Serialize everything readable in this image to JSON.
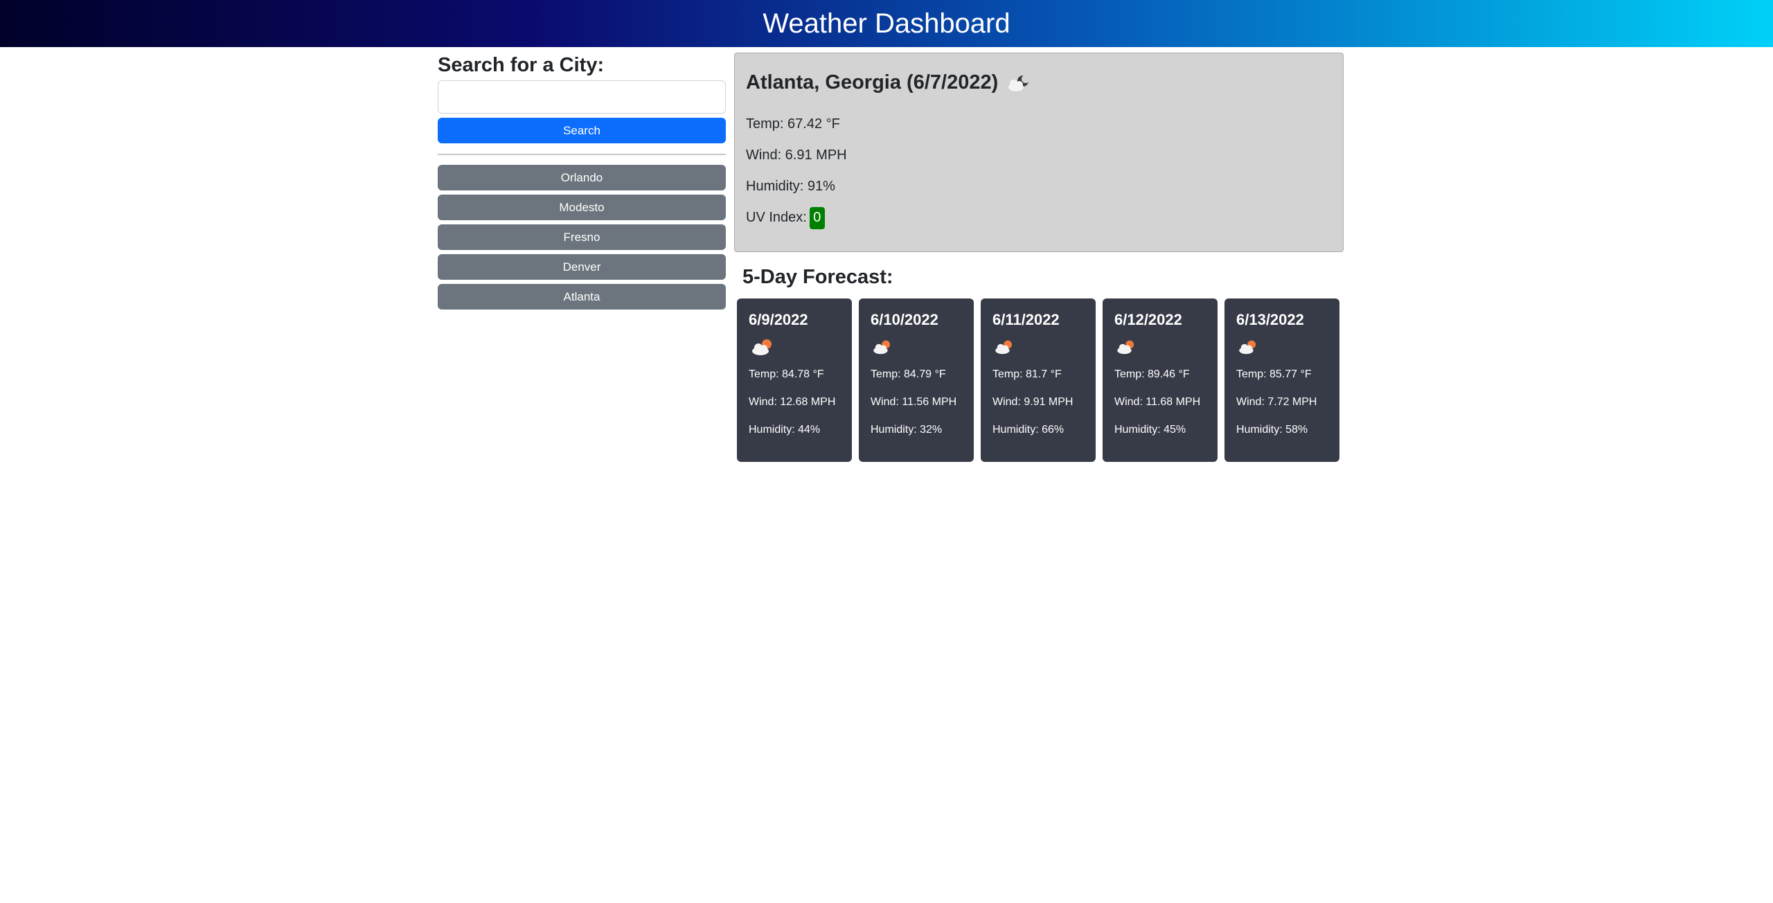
{
  "header": {
    "title": "Weather Dashboard"
  },
  "sidebar": {
    "heading": "Search for a City:",
    "search_value": "",
    "search_button": "Search",
    "history": [
      "Orlando",
      "Modesto",
      "Fresno",
      "Denver",
      "Atlanta"
    ]
  },
  "current": {
    "title": "Atlanta, Georgia (6/7/2022)",
    "icon": "cloud-moon-icon",
    "temp": "Temp: 67.42 °F",
    "wind": "Wind: 6.91 MPH",
    "humidity": "Humidity: 91%",
    "uv_label": "UV Index:",
    "uv_value": "0",
    "uv_color": "#008000"
  },
  "forecast": {
    "heading": "5-Day Forecast:",
    "days": [
      {
        "date": "6/9/2022",
        "icon": "cloud-sun-icon",
        "temp": "Temp: 84.78 °F",
        "wind": "Wind: 12.68 MPH",
        "humidity": "Humidity: 44%"
      },
      {
        "date": "6/10/2022",
        "icon": "cloud-sun-icon",
        "temp": "Temp: 84.79 °F",
        "wind": "Wind: 11.56 MPH",
        "humidity": "Humidity: 32%"
      },
      {
        "date": "6/11/2022",
        "icon": "cloud-sun-icon",
        "temp": "Temp: 81.7 °F",
        "wind": "Wind: 9.91 MPH",
        "humidity": "Humidity: 66%"
      },
      {
        "date": "6/12/2022",
        "icon": "cloud-sun-icon",
        "temp": "Temp: 89.46 °F",
        "wind": "Wind: 11.68 MPH",
        "humidity": "Humidity: 45%"
      },
      {
        "date": "6/13/2022",
        "icon": "cloud-sun-icon",
        "temp": "Temp: 85.77 °F",
        "wind": "Wind: 7.72 MPH",
        "humidity": "Humidity: 58%"
      }
    ]
  },
  "colors": {
    "primary_button": "#0d6efd",
    "history_button": "#6c757d",
    "forecast_card": "#373a47",
    "current_panel": "#d3d3d3"
  }
}
